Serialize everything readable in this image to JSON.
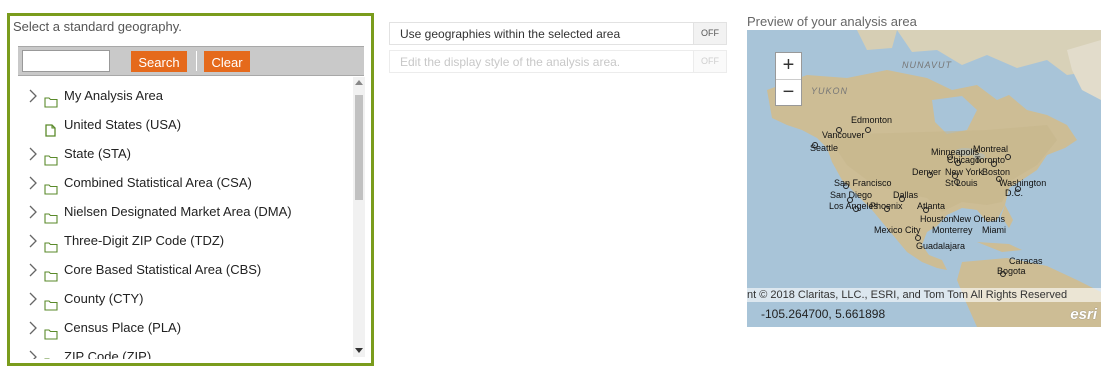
{
  "geography_panel": {
    "title": "Select a standard geography.",
    "search_input": {
      "value": "",
      "placeholder": ""
    },
    "search_button": "Search",
    "clear_button": "Clear",
    "items": [
      {
        "label": "My Analysis Area",
        "icon": "folder-icon",
        "expandable": true
      },
      {
        "label": "United States (USA)",
        "icon": "file-icon",
        "expandable": false
      },
      {
        "label": "State (STA)",
        "icon": "folder-icon",
        "expandable": true
      },
      {
        "label": "Combined Statistical Area (CSA)",
        "icon": "folder-icon",
        "expandable": true
      },
      {
        "label": "Nielsen Designated Market Area (DMA)",
        "icon": "folder-icon",
        "expandable": true
      },
      {
        "label": "Three-Digit ZIP Code (TDZ)",
        "icon": "folder-icon",
        "expandable": true
      },
      {
        "label": "Core Based Statistical Area (CBS)",
        "icon": "folder-icon",
        "expandable": true
      },
      {
        "label": "County (CTY)",
        "icon": "folder-icon",
        "expandable": true
      },
      {
        "label": "Census Place (PLA)",
        "icon": "folder-icon",
        "expandable": true
      },
      {
        "label": "ZIP Code (ZIP)",
        "icon": "folder-icon",
        "expandable": true
      }
    ]
  },
  "options": {
    "within_area": {
      "label": "Use geographies within the selected area",
      "toggle": "OFF",
      "enabled": true
    },
    "display_style": {
      "label": "Edit the display style of the analysis area.",
      "toggle": "OFF",
      "enabled": false
    }
  },
  "preview": {
    "title": "Preview of your analysis area",
    "zoom_in": "+",
    "zoom_out": "−",
    "regions": [
      "NUNAVUT",
      "YUKON"
    ],
    "cities": [
      "Edmonton",
      "Vancouver",
      "Seattle",
      "Minneapolis",
      "Montreal",
      "Chicago",
      "Toronto",
      "Denver",
      "New York",
      "Boston",
      "San Francisco",
      "St Louis",
      "Washington",
      "D.C.",
      "San Diego",
      "Dallas",
      "Los Angeles",
      "Phoenix",
      "Atlanta",
      "Houston",
      "New Orleans",
      "Mexico City",
      "Monterrey",
      "Miami",
      "Guadalajara",
      "Caracas",
      "Bogota"
    ],
    "attribution": "nt © 2018 Claritas, LLC., ESRI, and Tom Tom All Rights Reserved",
    "coordinates": "-105.264700, 5.661898",
    "logo": "esri"
  },
  "colors": {
    "panel_border": "#7a9c1c",
    "button_bg": "#e56a1c",
    "button_text": "#ffffff",
    "ocean": "#a8c4d8",
    "land": "#cdbd95"
  }
}
